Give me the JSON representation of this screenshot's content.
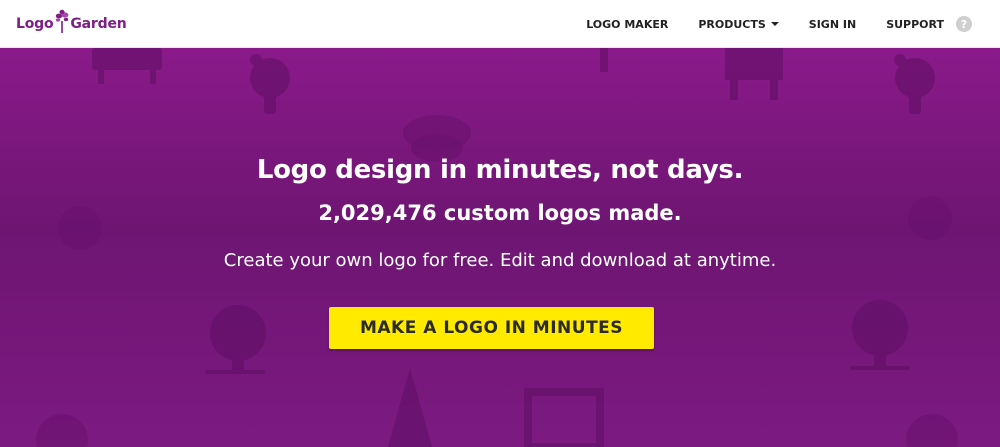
{
  "header": {
    "brand": {
      "name_left": "Logo",
      "name_right": "Garden",
      "icon": "tree-leaf-icon"
    },
    "nav": [
      {
        "label": "LOGO MAKER"
      },
      {
        "label": "PRODUCTS",
        "has_dropdown": true
      },
      {
        "label": "SIGN IN"
      },
      {
        "label": "SUPPORT"
      }
    ],
    "help": {
      "icon": "question-circle-icon",
      "glyph": "?"
    }
  },
  "hero": {
    "headline": "Logo design in minutes, not days.",
    "counter": "2,029,476 custom logos made.",
    "subline": "Create your own logo for free. Edit and download at anytime.",
    "cta_label": "MAKE A LOGO IN MINUTES"
  },
  "colors": {
    "brand_purple": "#7e1e86",
    "hero_purple": "#7a1a80",
    "cta_yellow": "#ffea00"
  }
}
